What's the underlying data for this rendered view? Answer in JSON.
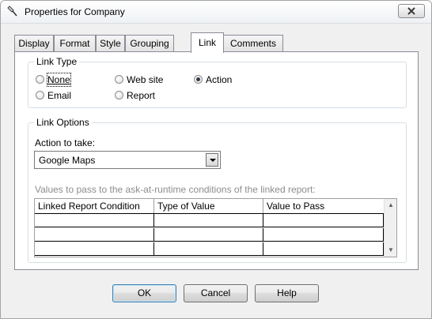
{
  "window": {
    "title": "Properties for Company"
  },
  "tabs": [
    {
      "label": "Display"
    },
    {
      "label": "Format"
    },
    {
      "label": "Style"
    },
    {
      "label": "Grouping"
    },
    {
      "label": "Link"
    },
    {
      "label": "Comments"
    }
  ],
  "active_tab": "Link",
  "link_type": {
    "legend": "Link Type",
    "options": [
      {
        "label": "None",
        "checked": false
      },
      {
        "label": "Web site",
        "checked": false
      },
      {
        "label": "Action",
        "checked": true
      },
      {
        "label": "Email",
        "checked": false
      },
      {
        "label": "Report",
        "checked": false
      }
    ]
  },
  "link_options": {
    "legend": "Link Options",
    "action_label": "Action to take:",
    "action_value": "Google Maps",
    "values_label": "Values to pass to the ask-at-runtime conditions of the linked report:",
    "grid": {
      "columns": [
        "Linked Report Condition",
        "Type of Value",
        "Value to Pass"
      ],
      "rows": [
        [
          "",
          "",
          ""
        ],
        [
          "",
          "",
          ""
        ],
        [
          "",
          "",
          ""
        ]
      ]
    }
  },
  "buttons": {
    "ok": "OK",
    "cancel": "Cancel",
    "help": "Help"
  },
  "icons": {
    "title": "pin-icon",
    "close": "close-icon",
    "dropdown": "chevron-down-icon",
    "scroll_up": "scroll-up-icon",
    "scroll_down": "scroll-down-icon"
  }
}
